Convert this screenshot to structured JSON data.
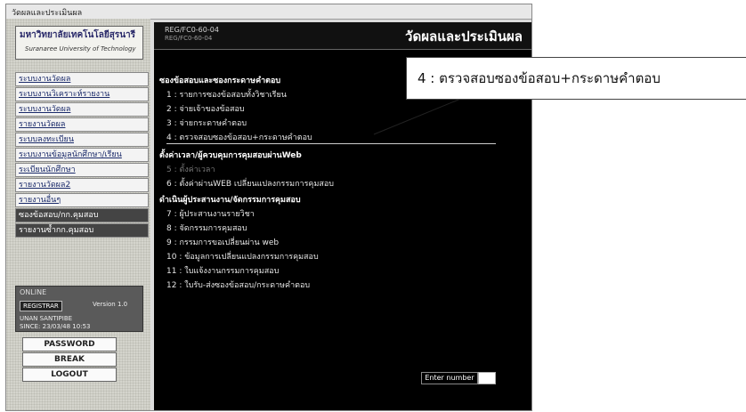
{
  "window": {
    "title": "วัดผลและประเมินผล"
  },
  "sidebar": {
    "logo_th": "มหาวิทยาลัยเทคโนโลยีสุรนารี",
    "logo_en": "Suranaree University of Technology",
    "items": [
      "ระบบงานวัดผล",
      "ระบบงานวิเคราะห์รายงาน",
      "ระบบงานวัดผล",
      "รายงานวัดผล",
      "ระบบลงทะเบียน",
      "ระบบงานข้อมูลนักศึกษา/เรียน",
      "ระเบียนนักศึกษา",
      "รายงานวัดผล2",
      "รายงานอื่นๆ",
      "ซองข้อสอบ/กก.คุมสอบ",
      "รายงานซ้ำกก.คุมสอบ"
    ],
    "status": {
      "check": "ONLINE",
      "pill": "REGISTRAR",
      "version": "Version 1.0",
      "user": "UNAN SANTIPIBE",
      "date": "SINCE: 23/03/48 10:53"
    },
    "buttons": {
      "password": "PASSWORD",
      "break": "BREAK",
      "logout": "LOGOUT"
    }
  },
  "main": {
    "code": "REG/FC0-60-04",
    "code_sub": "REG/FC0-60-04",
    "title": "วัดผลและประเมินผล",
    "section1": "ซองข้อสอบและซองกระดาษคำตอบ",
    "items1": [
      "1 : รายการซองข้อสอบทั้งวิชาเรียน",
      "2 : จ่ายเจ้าของข้อสอบ",
      "3 : จ่ายกระดาษคำตอบ",
      "4 : ตรวจสอบซองข้อสอบ+กระดาษคำตอบ"
    ],
    "section2": "ตั้งค่าเวลา/ผู้ควบคุมการคุมสอบผ่านWeb",
    "items2": [
      "5 : ตั้งค่าเวลา",
      "6 : ตั้งค่าผ่านWEB เปลี่ยนแปลงกรรมการคุมสอบ"
    ],
    "section3": "ดำเนินผู้ประสานงาน/จัดกรรมการคุมสอบ",
    "items3": [
      "7 : ผู้ประสานงานรายวิชา",
      "8 : จัดกรรมการคุมสอบ",
      "9 : กรรมการขอเปลี่ยนผ่าน web",
      "10 : ข้อมูลการเปลี่ยนแปลงกรรมการคุมสอบ",
      "11 : ใบแจ้งงานกรรมการคุมสอบ",
      "12 : ใบรับ-ส่งซองข้อสอบ/กระดาษคำตอบ"
    ],
    "enter_label": "Enter number"
  },
  "callout": {
    "text": "4 : ตรวจสอบซองข้อสอบ+กระดาษคำตอบ"
  }
}
